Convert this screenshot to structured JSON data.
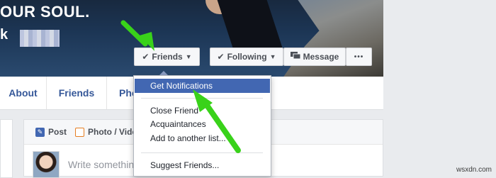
{
  "cover": {
    "text": "OUR SOUL.",
    "name_prefix": "k"
  },
  "profile_actions": {
    "friends_label": "Friends",
    "following_label": "Following",
    "message_label": "Message",
    "more_label": "•••"
  },
  "tabs": [
    "About",
    "Friends",
    "Pho"
  ],
  "composer": {
    "post_label": "Post",
    "photo_label": "Photo / Vide",
    "placeholder": "Write somethin"
  },
  "friends_menu": {
    "items": [
      {
        "label": "Get Notifications",
        "active": true
      },
      {
        "label": "Close Friend",
        "active": false
      },
      {
        "label": "Acquaintances",
        "active": false
      },
      {
        "label": "Add to another list...",
        "active": false
      },
      {
        "label": "Suggest Friends...",
        "active": false
      }
    ]
  },
  "colors": {
    "accent": "#4267b2",
    "link": "#365899",
    "annotation_arrow": "#39d21a"
  },
  "watermark": "wsxdn.com"
}
